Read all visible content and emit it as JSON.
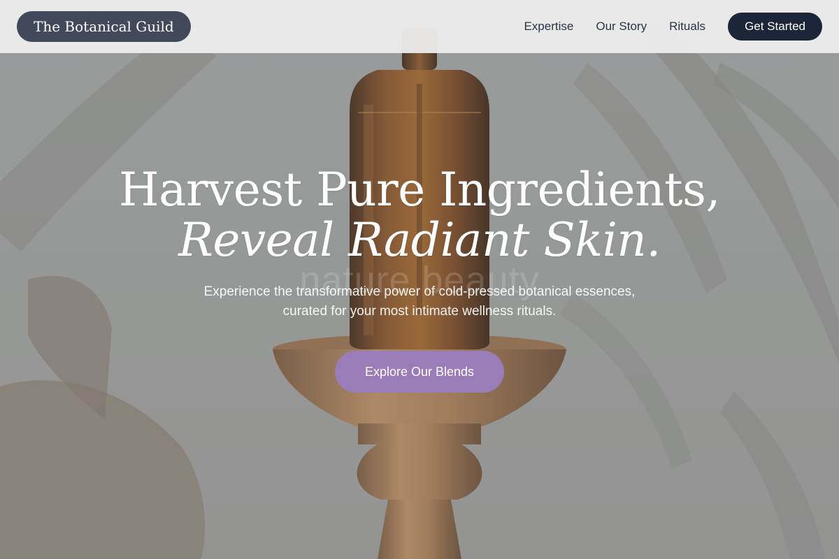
{
  "header": {
    "brand": "The Botanical Guild",
    "nav": [
      {
        "label": "Expertise"
      },
      {
        "label": "Our Story"
      },
      {
        "label": "Rituals"
      }
    ],
    "cta_label": "Get Started"
  },
  "hero": {
    "headline_line1": "Harvest Pure Ingredients,",
    "headline_line2": "Reveal Radiant Skin.",
    "ghost_text": "nature beauty",
    "subtitle": "Experience the transformative power of cold-pressed botanical essences, curated for your most intimate wellness rituals.",
    "button_label": "Explore Our Blends"
  },
  "colors": {
    "brand_pill": "#414a5b",
    "cta": "#1c2639",
    "accent": "#9a7cb8",
    "header_bg": "#eeeeee"
  },
  "images": {
    "background": "amber-dropper-bottle-on-wooden-pedestal-photo"
  }
}
